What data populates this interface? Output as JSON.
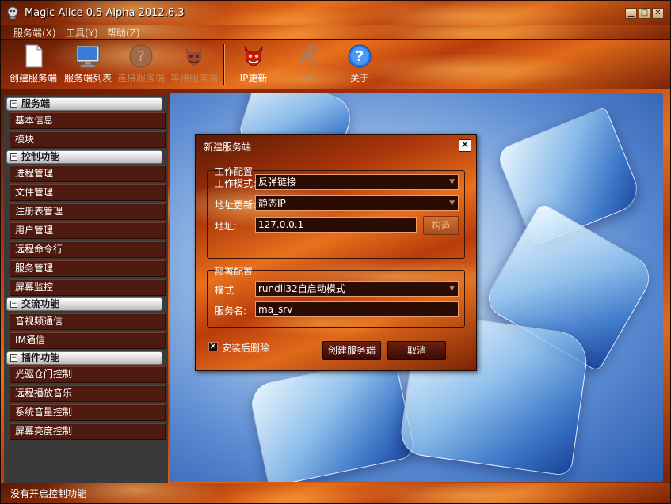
{
  "app": {
    "title": "Magic Alice 0.5 Alpha 2012.6.3"
  },
  "window_buttons": {
    "minimize": "▁",
    "maximize": "□",
    "close": "✕"
  },
  "menu": [
    {
      "label": "服务端(X)"
    },
    {
      "label": "工具(Y)"
    },
    {
      "label": "帮助(Z)"
    }
  ],
  "toolbar": [
    {
      "label": "创建服务端",
      "icon": "document-icon",
      "enabled": true
    },
    {
      "label": "服务端列表",
      "icon": "monitor-icon",
      "enabled": true
    },
    {
      "label": "连接服务端",
      "icon": "question-icon",
      "enabled": false
    },
    {
      "label": "等待服务端",
      "icon": "devil-icon",
      "enabled": false
    },
    {
      "label": "IP更新",
      "icon": "devil-icon",
      "enabled": true
    },
    {
      "label": "设置",
      "icon": "tools-icon",
      "enabled": false
    },
    {
      "label": "关于",
      "icon": "help-icon",
      "enabled": true
    }
  ],
  "sidebar": {
    "categories": [
      {
        "label": "服务端",
        "items": [
          "基本信息",
          "模块"
        ]
      },
      {
        "label": "控制功能",
        "items": [
          "进程管理",
          "文件管理",
          "注册表管理",
          "用户管理",
          "远程命令行",
          "服务管理",
          "屏幕监控"
        ]
      },
      {
        "label": "交流功能",
        "items": [
          "音视频通信",
          "IM通信"
        ]
      },
      {
        "label": "插件功能",
        "items": [
          "光驱仓门控制",
          "远程播放音乐",
          "系统音量控制",
          "屏幕亮度控制"
        ]
      }
    ]
  },
  "dialog": {
    "title": "新建服务端",
    "close": "✕",
    "work_group": {
      "title": "工作配置",
      "mode_label": "工作模式:",
      "mode_value": "反弹链接",
      "update_label": "地址更新:",
      "update_value": "静态IP",
      "address_label": "地址:",
      "address_value": "127.0.0.1",
      "build_button": "构造"
    },
    "deploy_group": {
      "title": "部署配置",
      "mode_label": "模式",
      "mode_value": "rundll32自启动模式",
      "service_label": "服务名:",
      "service_value": "ma_srv"
    },
    "delete_after_install": {
      "label": "安装后删除",
      "checked": true,
      "mark": "✕"
    },
    "create_button": "创建服务端",
    "cancel_button": "取消"
  },
  "status": {
    "text": "没有开启控制功能"
  }
}
